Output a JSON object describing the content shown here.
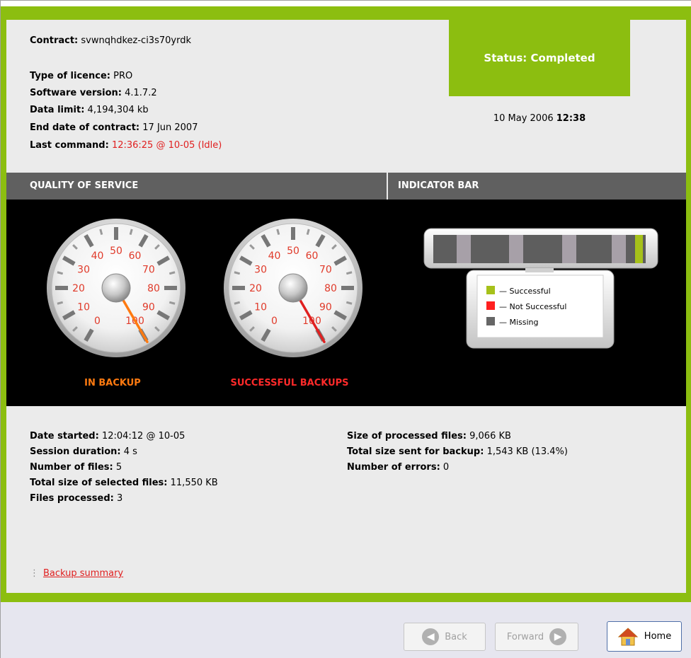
{
  "contract": {
    "label": "Contract:",
    "value": "svwnqhdkez-ci3s70yrdk"
  },
  "details": [
    {
      "label": "Type of licence:",
      "value": "PRO"
    },
    {
      "label": "Software version:",
      "value": "4.1.7.2"
    },
    {
      "label": "Data limit:",
      "value": "4,194,304 kb"
    },
    {
      "label": "End date of contract:",
      "value": "17 Jun 2007"
    },
    {
      "label": "Last command:",
      "value": "12:36:25 @ 10-05 (Idle)"
    }
  ],
  "status": {
    "text": "Status: Completed",
    "date": "10 May 2006",
    "time": "12:38",
    "color": "#8cbe10"
  },
  "sections": {
    "qos": "QUALITY OF SERVICE",
    "indicator": "INDICATOR BAR"
  },
  "gauges": [
    {
      "label": "IN BACKUP",
      "value": 100,
      "needle_color": "#ff7a10",
      "label_color": "#ff7a10"
    },
    {
      "label": "SUCCESSFUL BACKUPS",
      "value": 100,
      "needle_color": "#e02020",
      "label_color": "#ff2a2a"
    }
  ],
  "gauge_ticks": [
    "0",
    "10",
    "20",
    "30",
    "40",
    "50",
    "60",
    "70",
    "80",
    "90",
    "100"
  ],
  "legend": [
    {
      "label": "— Successful",
      "color": "#a6c11a"
    },
    {
      "label": "— Not Successful",
      "color": "#ff2020"
    },
    {
      "label": "— Missing",
      "color": "#666666"
    }
  ],
  "left_stats": [
    {
      "label": "Date started:",
      "value": "12:04:12 @ 10-05"
    },
    {
      "label": "Session duration:",
      "value": "4 s"
    },
    {
      "label": "Number of files:",
      "value": "5"
    },
    {
      "label": "Total size of selected files:",
      "value": "11,550 KB"
    },
    {
      "label": "Files processed:",
      "value": "3"
    }
  ],
  "right_stats": [
    {
      "label": "Size of processed files:",
      "value": "9,066 KB"
    },
    {
      "label": "Total size sent for backup:",
      "value": "1,543 KB (13.4%)"
    },
    {
      "label": "Number of errors:",
      "value": "0"
    }
  ],
  "summary_link": "Backup summary",
  "footer": {
    "back": "Back",
    "forward": "Forward",
    "home": "Home"
  }
}
